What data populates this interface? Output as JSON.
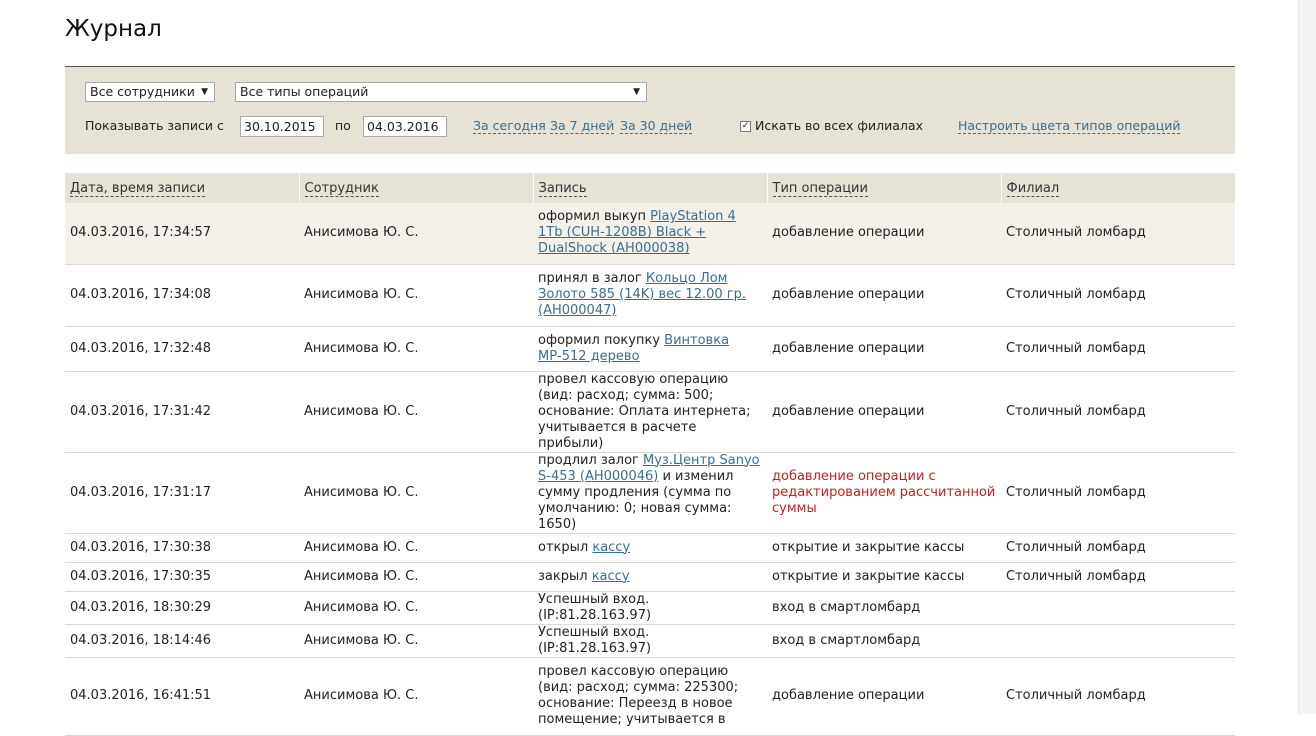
{
  "page_title": "Журнал",
  "filters": {
    "employee_select": "Все сотрудники",
    "operation_type_select": "Все типы операций",
    "show_records_from_label": "Показывать записи с",
    "date_from": "30.10.2015",
    "to_label": "по",
    "date_to": "04.03.2016",
    "today_link": "За сегодня",
    "last7_link": "За 7 дней",
    "last30_link": "За 30 дней",
    "all_branches_checked": true,
    "all_branches_label": "Искать во всех филиалах",
    "configure_colors_link": "Настроить цвета типов операций"
  },
  "table": {
    "columns": [
      "Дата, время записи",
      "Сотрудник",
      "Запись",
      "Тип операции",
      "Филиал"
    ],
    "rows": [
      {
        "datetime": "04.03.2016, 17:34:57",
        "employee": "Анисимова Ю. С.",
        "record_text": "оформил выкуп ",
        "record_link": "PlayStation 4 1Tb (CUH-1208B) Black + DualShock (АН000038)",
        "record_suffix": "",
        "type": "добавление операции",
        "type_color": "",
        "branch": "Столичный ломбард"
      },
      {
        "datetime": "04.03.2016, 17:34:08",
        "employee": "Анисимова Ю. С.",
        "record_text": "принял в залог ",
        "record_link": "Кольцо Лом Золото 585 (14K) вес 12.00 гр. (АН000047)",
        "record_suffix": "",
        "type": "добавление операции",
        "type_color": "",
        "branch": "Столичный ломбард"
      },
      {
        "datetime": "04.03.2016, 17:32:48",
        "employee": "Анисимова Ю. С.",
        "record_text": "оформил покупку ",
        "record_link": "Винтовка МР-512 дерево",
        "record_suffix": "",
        "type": "добавление операции",
        "type_color": "",
        "branch": "Столичный ломбард"
      },
      {
        "datetime": "04.03.2016, 17:31:42",
        "employee": "Анисимова Ю. С.",
        "record_text": "провел кассовую операцию (вид: расход; сумма: 500; основание: Оплата интернета; учитывается в расчете прибыли)",
        "record_link": "",
        "record_suffix": "",
        "type": "добавление операции",
        "type_color": "",
        "branch": "Столичный ломбард"
      },
      {
        "datetime": "04.03.2016, 17:31:17",
        "employee": "Анисимова Ю. С.",
        "record_text": "продлил залог ",
        "record_link": "Муз.Центр Sanyo S-453 (АН000046)",
        "record_suffix": " и изменил сумму продления (сумма по умолчанию: 0; новая сумма: 1650)",
        "type": "добавление операции с редактированием рассчитанной суммы",
        "type_color": "#c81e1e",
        "branch": "Столичный ломбард"
      },
      {
        "datetime": "04.03.2016, 17:30:38",
        "employee": "Анисимова Ю. С.",
        "record_text": "открыл ",
        "record_link": "кассу",
        "record_suffix": "",
        "type": "открытие и закрытие кассы",
        "type_color": "",
        "branch": "Столичный ломбард"
      },
      {
        "datetime": "04.03.2016, 17:30:35",
        "employee": "Анисимова Ю. С.",
        "record_text": "закрыл ",
        "record_link": "кассу",
        "record_suffix": "",
        "type": "открытие и закрытие кассы",
        "type_color": "",
        "branch": "Столичный ломбард"
      },
      {
        "datetime": "04.03.2016, 18:30:29",
        "employee": "Анисимова Ю. С.",
        "record_text": "Успешный вход. (IP:81.28.163.97)",
        "record_link": "",
        "record_suffix": "",
        "type": "вход в смартломбард",
        "type_color": "",
        "branch": ""
      },
      {
        "datetime": "04.03.2016, 18:14:46",
        "employee": "Анисимова Ю. С.",
        "record_text": "Успешный вход. (IP:81.28.163.97)",
        "record_link": "",
        "record_suffix": "",
        "type": "вход в смартломбард",
        "type_color": "",
        "branch": ""
      },
      {
        "datetime": "04.03.2016, 16:41:51",
        "employee": "Анисимова Ю. С.",
        "record_text": "провел кассовую операцию (вид: расход; сумма: 225300; основание: Переезд в новое помещение; учитывается в",
        "record_link": "",
        "record_suffix": "",
        "type": "добавление операции",
        "type_color": "",
        "branch": "Столичный ломбард"
      }
    ]
  }
}
